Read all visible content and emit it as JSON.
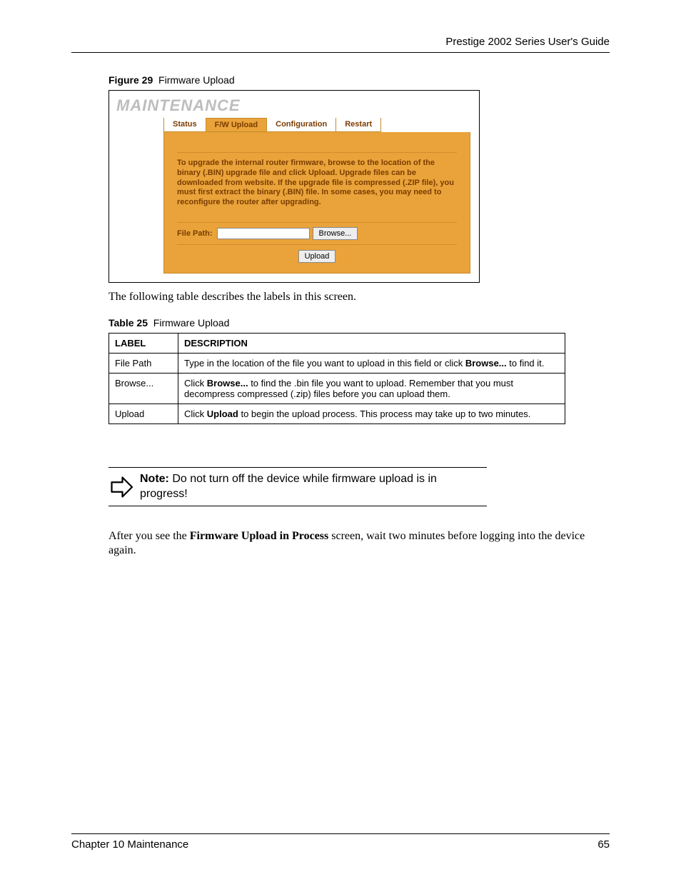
{
  "header": {
    "title": "Prestige 2002 Series User's Guide"
  },
  "figure": {
    "label": "Figure 29",
    "caption": "Firmware Upload"
  },
  "screenshot": {
    "title": "MAINTENANCE",
    "tabs": [
      "Status",
      "F/W Upload",
      "Configuration",
      "Restart"
    ],
    "instruction": "To upgrade the internal router firmware, browse to the location of the binary (.BIN) upgrade file and click Upload. Upgrade files can be downloaded from website. If the upgrade file is compressed (.ZIP file), you must first extract the binary (.BIN) file. In some cases, you may need to reconfigure the router after upgrading.",
    "filepath_label": "File Path:",
    "browse_label": "Browse...",
    "upload_label": "Upload"
  },
  "intro_text": "The following table describes the labels in this screen.",
  "table": {
    "label": "Table 25",
    "caption": "Firmware Upload",
    "headers": {
      "col1": "LABEL",
      "col2": "DESCRIPTION"
    },
    "rows": [
      {
        "label": "File Path",
        "desc_pre": "Type in the location of the file you want to upload in this field or click ",
        "desc_bold": "Browse...",
        "desc_post": " to find it."
      },
      {
        "label": "Browse...",
        "desc_pre": "Click ",
        "desc_bold": "Browse...",
        "desc_post": " to find the .bin file you want to upload. Remember that you must decompress compressed (.zip) files before you can upload them."
      },
      {
        "label": "Upload",
        "desc_pre": "Click ",
        "desc_bold": "Upload",
        "desc_post": " to begin the upload process. This process may take up to two minutes."
      }
    ]
  },
  "note": {
    "prefix": "Note:",
    "text": " Do not turn off the device while firmware upload is in progress!"
  },
  "after_note_pre": "After you see the ",
  "after_note_bold": "Firmware Upload in Process",
  "after_note_post": " screen, wait two minutes before logging into the device again.",
  "footer": {
    "left": "Chapter 10 Maintenance",
    "right": "65"
  }
}
